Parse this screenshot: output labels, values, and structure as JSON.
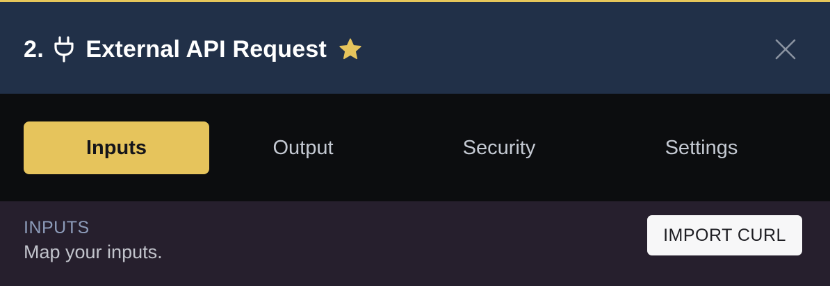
{
  "header": {
    "step_number": "2.",
    "title": "External API Request",
    "icons": {
      "step": "plug-icon",
      "favorite": "star-icon",
      "close": "close-icon"
    },
    "favorite_color": "#e6c45c"
  },
  "tabs": [
    {
      "label": "Inputs",
      "active": true
    },
    {
      "label": "Output",
      "active": false
    },
    {
      "label": "Security",
      "active": false
    },
    {
      "label": "Settings",
      "active": false
    }
  ],
  "section": {
    "heading": "INPUTS",
    "description": "Map your inputs.",
    "import_button_label": "IMPORT CURL"
  },
  "colors": {
    "accent": "#e6c45c",
    "header_bg": "#213048",
    "tabs_bg": "#0c0d0f",
    "section_bg": "#261f2d"
  }
}
